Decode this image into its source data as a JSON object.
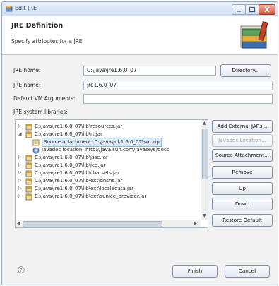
{
  "window": {
    "title": "Edit JRE",
    "controls": [
      "minimize-icon",
      "maximize-icon",
      "close-icon"
    ]
  },
  "header": {
    "title": "JRE Definition",
    "subtitle": "Specify attributes for a JRE",
    "banner_icon": "books-icon"
  },
  "form": {
    "jre_home_label": "JRE home:",
    "jre_home_value": "C:\\Java\\jre1.6.0_07",
    "directory_button": "Directory...",
    "jre_name_label": "JRE name:",
    "jre_name_value": "jre1.6.0_07",
    "vm_args_label": "Default VM Arguments:",
    "vm_args_value": "",
    "libraries_label": "JRE system libraries:"
  },
  "libraries": [
    {
      "text": "C:\\Java\\jre1.6.0_07\\lib\\resources.jar",
      "level": 0,
      "expander": "collapsed",
      "icon": "jar-icon"
    },
    {
      "text": "C:\\Java\\jre1.6.0_07\\lib\\rt.jar",
      "level": 0,
      "expander": "expanded",
      "icon": "jar-icon"
    },
    {
      "text": "Source attachment: C:\\Java\\jdk1.6.0_07\\src.zip",
      "level": 1,
      "expander": "none",
      "icon": "source-attachment-icon",
      "selected": true
    },
    {
      "text": "Javadoc location: http://java.sun.com/javase/6/docs",
      "level": 1,
      "expander": "none",
      "icon": "javadoc-icon"
    },
    {
      "text": "C:\\Java\\jre1.6.0_07\\lib\\jsse.jar",
      "level": 0,
      "expander": "collapsed",
      "icon": "jar-icon"
    },
    {
      "text": "C:\\Java\\jre1.6.0_07\\lib\\jce.jar",
      "level": 0,
      "expander": "collapsed",
      "icon": "jar-icon"
    },
    {
      "text": "C:\\Java\\jre1.6.0_07\\lib\\charsets.jar",
      "level": 0,
      "expander": "collapsed",
      "icon": "jar-icon"
    },
    {
      "text": "C:\\Java\\jre1.6.0_07\\lib\\ext\\dnsns.jar",
      "level": 0,
      "expander": "collapsed",
      "icon": "jar-icon"
    },
    {
      "text": "C:\\Java\\jre1.6.0_07\\lib\\ext\\localedata.jar",
      "level": 0,
      "expander": "collapsed",
      "icon": "jar-icon"
    },
    {
      "text": "C:\\Java\\jre1.6.0_07\\lib\\ext\\sunjce_provider.jar",
      "level": 0,
      "expander": "collapsed",
      "icon": "jar-icon"
    }
  ],
  "side_buttons": {
    "add_external_jars": "Add External JARs...",
    "javadoc_location": "Javadoc Location...",
    "source_attachment": "Source Attachment...",
    "remove": "Remove",
    "up": "Up",
    "down": "Down",
    "restore_default": "Restore Default"
  },
  "footer": {
    "help_icon": "help-icon",
    "finish": "Finish",
    "cancel": "Cancel"
  },
  "colors": {
    "selection": "#dcebfb",
    "title_bar": "#cfddef",
    "close_button": "#d0553a"
  }
}
